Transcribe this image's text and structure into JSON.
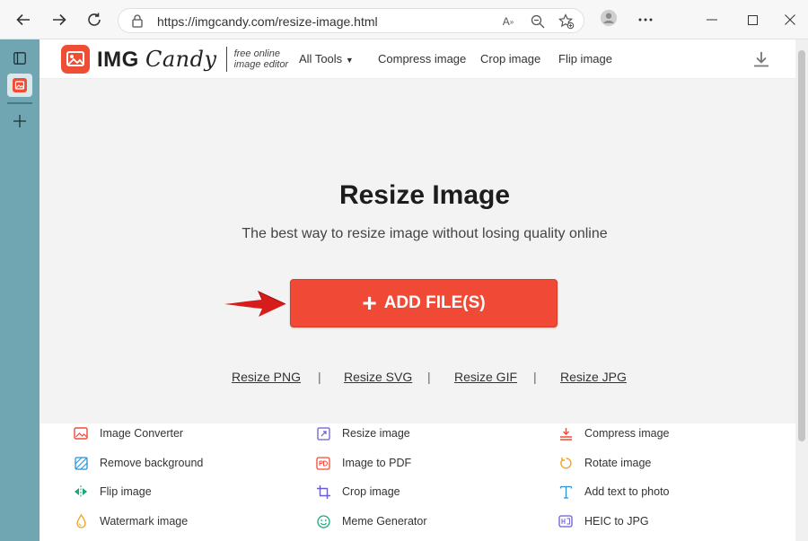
{
  "browser": {
    "url": "https://imgcandy.com/resize-image.html"
  },
  "header": {
    "logo_img": "IMG",
    "logo_candy": "Candy",
    "tagline_1": "free online",
    "tagline_2": "image editor",
    "menu": [
      "All Tools",
      "Compress image",
      "Crop image",
      "Flip image"
    ]
  },
  "hero": {
    "title": "Resize Image",
    "subtitle": "The best way to resize image without losing quality online",
    "add_button": "ADD FILE(S)",
    "formats": [
      "Resize PNG",
      "Resize SVG",
      "Resize GIF",
      "Resize JPG"
    ],
    "separator": "|"
  },
  "tools": [
    {
      "label": "Image Converter",
      "icon": "image-converter-icon"
    },
    {
      "label": "Resize image",
      "icon": "resize-icon"
    },
    {
      "label": "Compress image",
      "icon": "compress-icon"
    },
    {
      "label": "Remove background",
      "icon": "remove-background-icon"
    },
    {
      "label": "Image to PDF",
      "icon": "pdf-icon"
    },
    {
      "label": "Rotate image",
      "icon": "rotate-icon"
    },
    {
      "label": "Flip image",
      "icon": "flip-icon"
    },
    {
      "label": "Crop image",
      "icon": "crop-icon"
    },
    {
      "label": "Add text to photo",
      "icon": "text-icon"
    },
    {
      "label": "Watermark image",
      "icon": "watermark-icon"
    },
    {
      "label": "Meme Generator",
      "icon": "meme-icon"
    },
    {
      "label": "HEIC to JPG",
      "icon": "heic-icon"
    }
  ],
  "colors": {
    "accent": "#f04a36",
    "rail": "#6fa6b2"
  }
}
